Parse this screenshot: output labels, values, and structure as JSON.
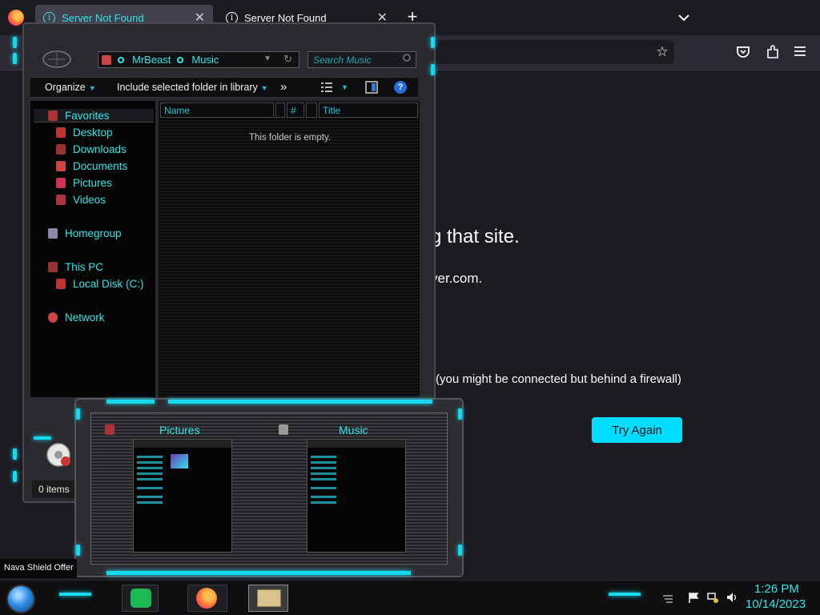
{
  "firefox": {
    "tabs": [
      {
        "label": "Server Not Found",
        "active": true
      },
      {
        "label": "Server Not Found",
        "active": false
      }
    ],
    "new_tab": "+",
    "error": {
      "heading_fragment": "g that site.",
      "domain_fragment": "ver.com.",
      "firewall_note": "(you might be connected but behind a firewall)",
      "button": "Try Again"
    }
  },
  "explorer": {
    "breadcrumb": [
      "MrBeast",
      "Music"
    ],
    "search_placeholder": "Search Music",
    "commands": {
      "organize": "Organize",
      "include": "Include selected folder in library",
      "more": "»"
    },
    "columns": [
      "Name",
      "#",
      "Title"
    ],
    "empty_message": "This folder is empty.",
    "nav": {
      "favorites": "Favorites",
      "favorites_items": [
        "Desktop",
        "Downloads",
        "Documents",
        "Pictures",
        "Videos"
      ],
      "homegroup": "Homegroup",
      "this_pc": "This PC",
      "local_disk": "Local Disk (C:)",
      "network": "Network"
    },
    "status": "0 items"
  },
  "thumbnails": [
    {
      "title": "Pictures"
    },
    {
      "title": "Music"
    }
  ],
  "taskbar": {
    "notification": "Nava Shield Offer",
    "time": "1:26 PM",
    "date": "10/14/2023"
  },
  "colors": {
    "accent": "#2ee6e6",
    "try_again": "#00ddff",
    "firefox_bg": "#1c1b22"
  }
}
